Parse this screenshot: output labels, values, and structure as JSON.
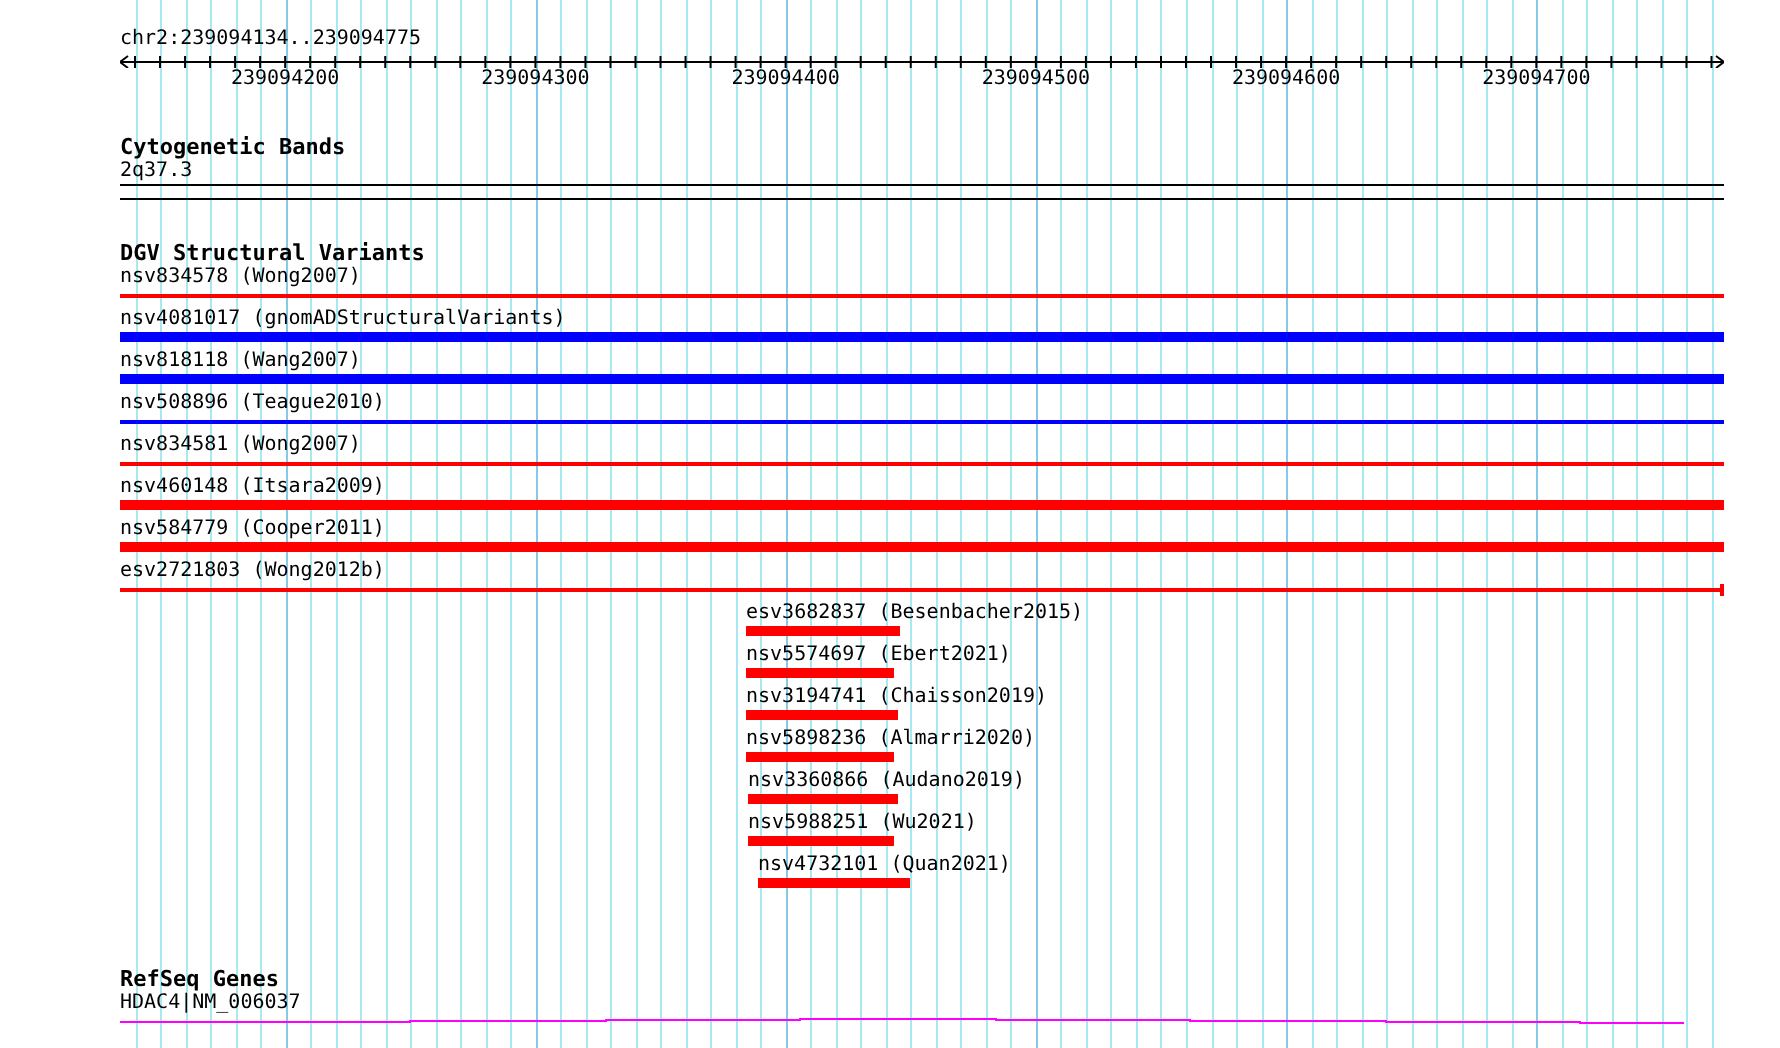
{
  "ruler": {
    "region": "chr2:239094134..239094775",
    "ticks": [
      "239094200",
      "239094300",
      "239094400",
      "239094500",
      "239094600",
      "239094700"
    ]
  },
  "cytogenetic_bands": {
    "title": "Cytogenetic Bands",
    "band": "2q37.3"
  },
  "structural_variants": {
    "title": "DGV Structural Variants",
    "variants": [
      {
        "label": "nsv834578 (Wong2007)",
        "kind": "thin",
        "color": "#ff0000"
      },
      {
        "label": "nsv4081017 (gnomADStructuralVariants)",
        "kind": "thick",
        "color": "#0000ff"
      },
      {
        "label": "nsv818118 (Wang2007)",
        "kind": "thick",
        "color": "#0000ff"
      },
      {
        "label": "nsv508896 (Teague2010)",
        "kind": "thin",
        "color": "#0000ff"
      },
      {
        "label": "nsv834581 (Wong2007)",
        "kind": "thin",
        "color": "#ff0000"
      },
      {
        "label": "nsv460148 (Itsara2009)",
        "kind": "thick",
        "color": "#ff0000"
      },
      {
        "label": "nsv584779 (Cooper2011)",
        "kind": "thick",
        "color": "#ff0000"
      },
      {
        "label": "esv2721803 (Wong2012b)",
        "kind": "thin-end",
        "color": "#ff0000"
      },
      {
        "label": "esv3682837 (Besenbacher2015)",
        "kind": "short",
        "color": "#ff0000"
      },
      {
        "label": "nsv5574697 (Ebert2021)",
        "kind": "short",
        "color": "#ff0000"
      },
      {
        "label": "nsv3194741 (Chaisson2019)",
        "kind": "short",
        "color": "#ff0000"
      },
      {
        "label": "nsv5898236 (Almarri2020)",
        "kind": "short",
        "color": "#ff0000"
      },
      {
        "label": "nsv3360866 (Audano2019)",
        "kind": "short",
        "color": "#ff0000"
      },
      {
        "label": "nsv5988251 (Wu2021)",
        "kind": "short",
        "color": "#ff0000"
      },
      {
        "label": "nsv4732101 (Quan2021)",
        "kind": "short",
        "color": "#ff0000"
      }
    ]
  },
  "refseq_genes": {
    "title": "RefSeq Genes",
    "gene": "HDAC4|NM_006037"
  }
}
